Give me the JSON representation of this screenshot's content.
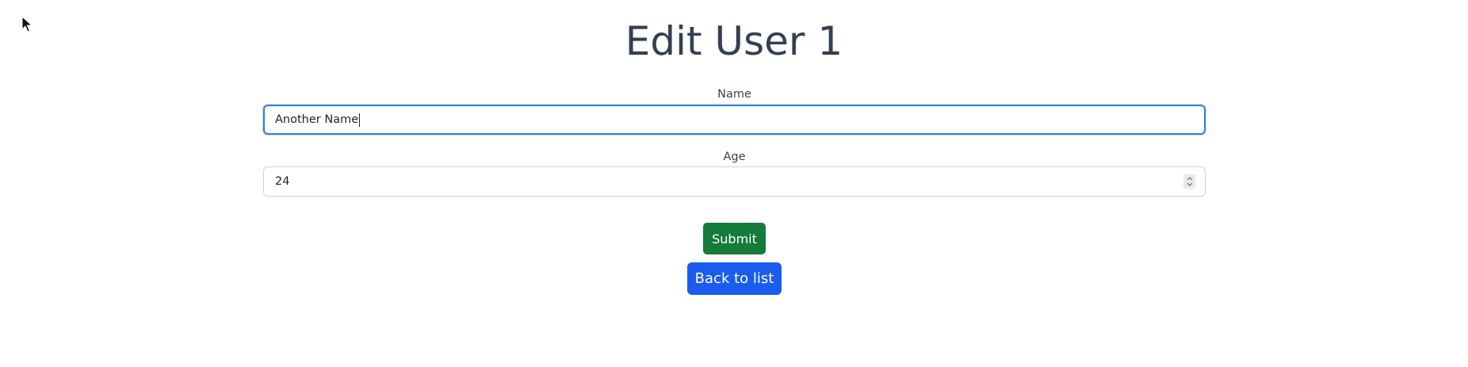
{
  "page": {
    "title": "Edit User 1"
  },
  "form": {
    "name": {
      "label": "Name",
      "value": "Another Name"
    },
    "age": {
      "label": "Age",
      "value": "24"
    },
    "submit_label": "Submit",
    "back_label": "Back to list"
  },
  "colors": {
    "submit_button": "#157a3a",
    "back_button": "#1a5cf0",
    "focus_border": "#2f7de1",
    "title_text": "#343f52"
  },
  "icons": {
    "cursor": "mouse-pointer-icon",
    "spinner_up": "chevron-up-icon",
    "spinner_down": "chevron-down-icon"
  }
}
